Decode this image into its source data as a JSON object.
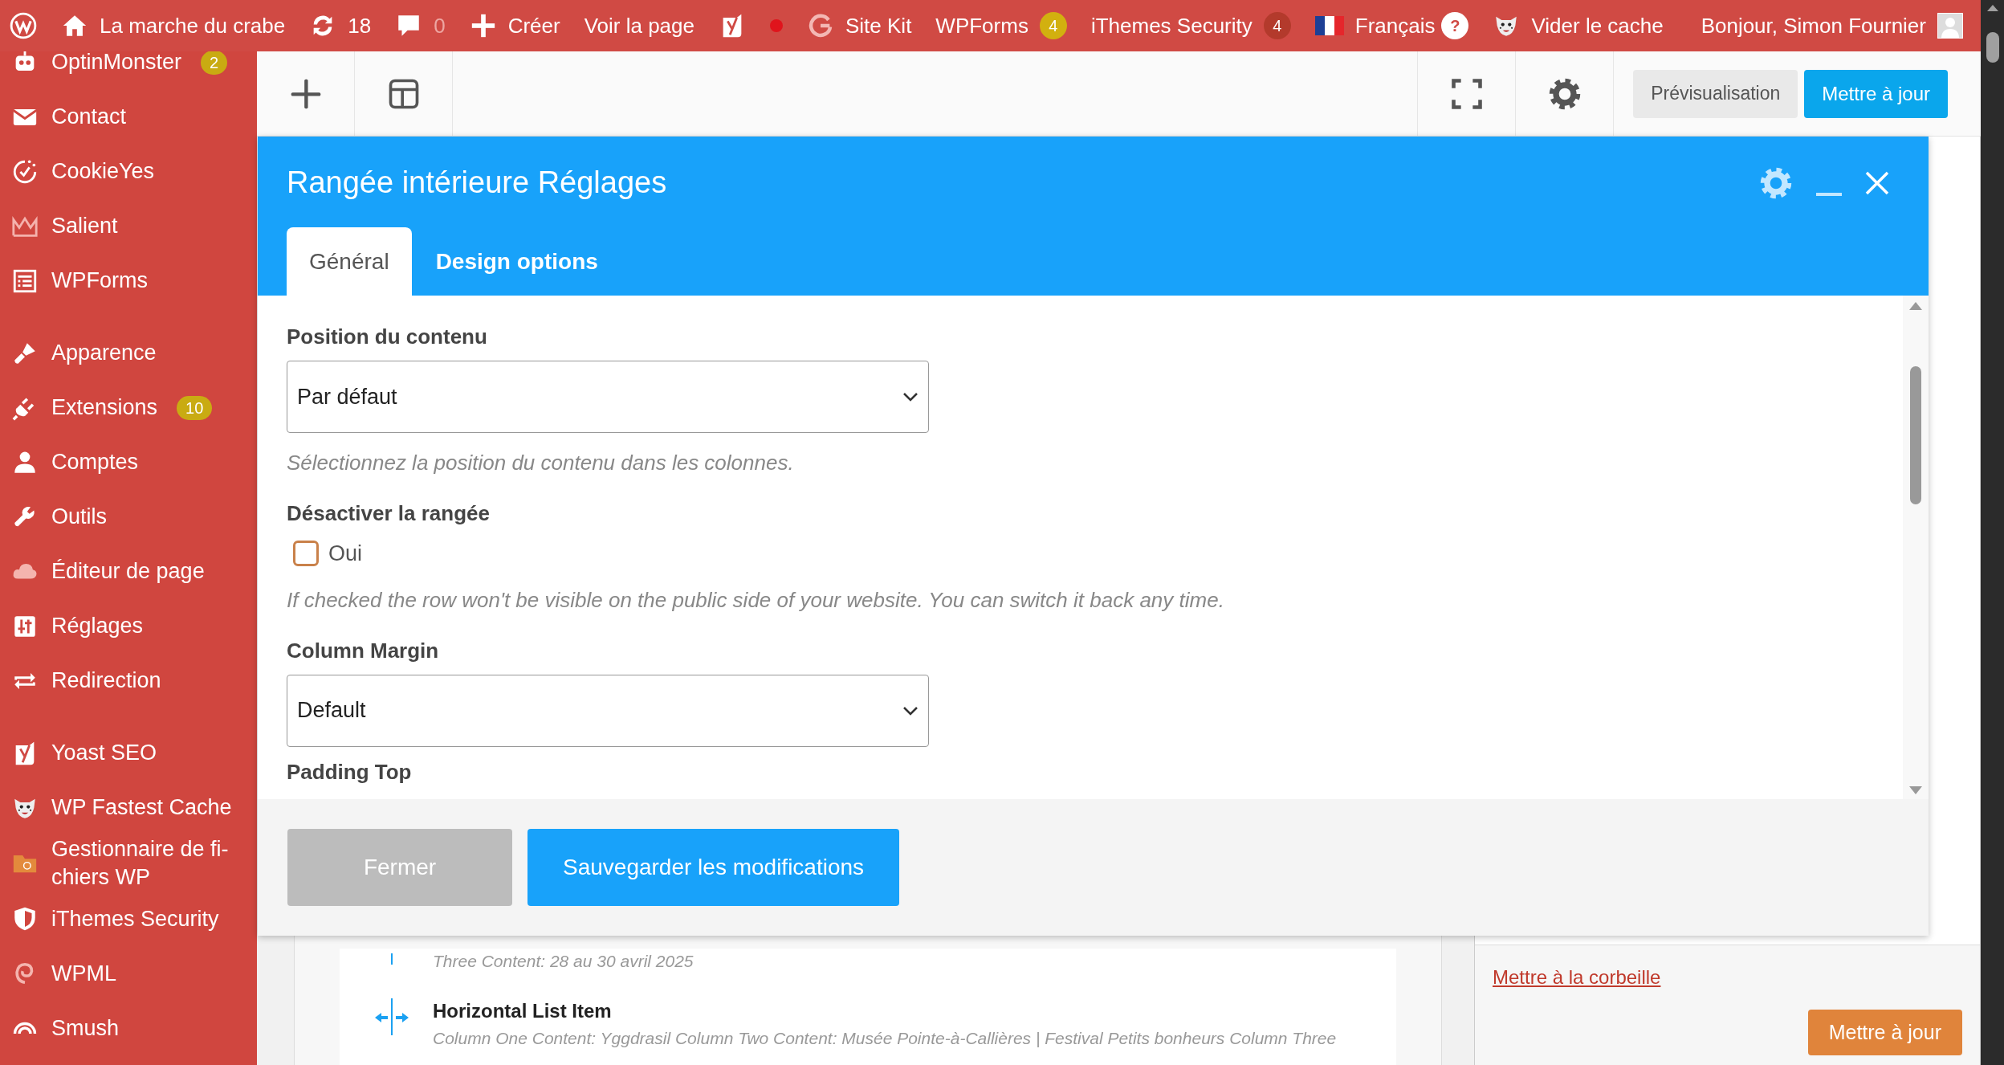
{
  "admin_bar": {
    "items": [
      {
        "kind": "wordpress"
      },
      {
        "kind": "home",
        "label": "La marche du crabe"
      },
      {
        "kind": "updates",
        "label": "18"
      },
      {
        "kind": "comments",
        "label": "0",
        "dimmed": true
      },
      {
        "kind": "plus",
        "label": "Créer"
      },
      {
        "kind": "text",
        "label": "Voir la page"
      },
      {
        "kind": "yoast"
      },
      {
        "kind": "dot",
        "color": "#e0141c"
      },
      {
        "kind": "google",
        "label": "Site Kit"
      },
      {
        "kind": "text",
        "label": "WPForms",
        "badge": {
          "text": "4",
          "color": "#d2b00f"
        }
      },
      {
        "kind": "text",
        "label": "iThemes Security",
        "badge": {
          "text": "4",
          "color": "#b33a2c"
        }
      },
      {
        "kind": "flag",
        "label": "Français"
      },
      {
        "kind": "help",
        "label": "?"
      },
      {
        "kind": "cheetah",
        "label": "Vider le cache"
      }
    ],
    "account": {
      "label": "Bonjour, Simon Fournier"
    }
  },
  "sidebar": {
    "groups": [
      [
        {
          "kind": "robot",
          "label": "OptinMonster",
          "badge": "2"
        },
        {
          "kind": "mail",
          "label": "Contact"
        },
        {
          "kind": "cookie",
          "label": "CookieYes"
        },
        {
          "kind": "crown",
          "label": "Salient"
        },
        {
          "kind": "form",
          "label": "WPForms"
        }
      ],
      [
        {
          "kind": "brush",
          "label": "Apparence"
        },
        {
          "kind": "plug",
          "label": "Extensions",
          "badge": "10"
        },
        {
          "kind": "user",
          "label": "Comptes"
        },
        {
          "kind": "wrench",
          "label": "Outils"
        },
        {
          "kind": "cloud",
          "label": "Éditeur de page"
        },
        {
          "kind": "sliders",
          "label": "Réglages"
        },
        {
          "kind": "loop",
          "label": "Redirection"
        }
      ],
      [
        {
          "kind": "yoast",
          "label": "Yoast SEO"
        },
        {
          "kind": "cheetah",
          "label": "WP Fastest Cache"
        },
        {
          "kind": "folder",
          "label": "Gestionnaire de fi-\nchiers WP"
        },
        {
          "kind": "shield",
          "label": "iThemes Security"
        },
        {
          "kind": "wpml",
          "label": "WPML"
        },
        {
          "kind": "smush",
          "label": "Smush"
        }
      ]
    ]
  },
  "toolbar": {
    "left": [
      {
        "kind": "add"
      },
      {
        "kind": "layout"
      }
    ],
    "right": [
      {
        "kind": "fullscreen"
      },
      {
        "kind": "settings"
      }
    ],
    "buttons": [
      {
        "label": "Prévisualisation",
        "kind": "secondary"
      },
      {
        "label": "Mettre à jour",
        "kind": "primary"
      }
    ]
  },
  "builder_list": [
    {
      "description": "Three Content: 28 au 30 avril 2025"
    },
    {
      "title": "Horizontal List Item",
      "description": "Column One Content: Yggdrasil  Column Two Content: Musée Pointe-à-Callières | Festival Petits bonheurs  Column Three"
    }
  ],
  "publish_box": {
    "trash_link": "Mettre à la corbeille",
    "update_button": "Mettre à jour"
  },
  "modal": {
    "title": "Rangée intérieure Réglages",
    "tabs": [
      {
        "label": "Général",
        "selected": true
      },
      {
        "label": "Design options",
        "selected": false
      }
    ],
    "fields": [
      {
        "kind": "select",
        "label": "Position du contenu",
        "value": "Par défaut",
        "help": "Sélectionnez la position du contenu dans les colonnes."
      },
      {
        "kind": "checkbox",
        "label": "Désactiver la rangée",
        "option": "Oui",
        "checked": false,
        "help": "If checked the row won't be visible on the public side of your website. You can switch it back any time."
      },
      {
        "kind": "select",
        "label": "Column Margin",
        "value": "Default"
      },
      {
        "kind": "heading",
        "label": "Padding Top"
      }
    ],
    "buttons": [
      {
        "label": "Fermer",
        "kind": "secondary"
      },
      {
        "label": "Sauvegarder les modifications",
        "kind": "primary"
      }
    ]
  }
}
